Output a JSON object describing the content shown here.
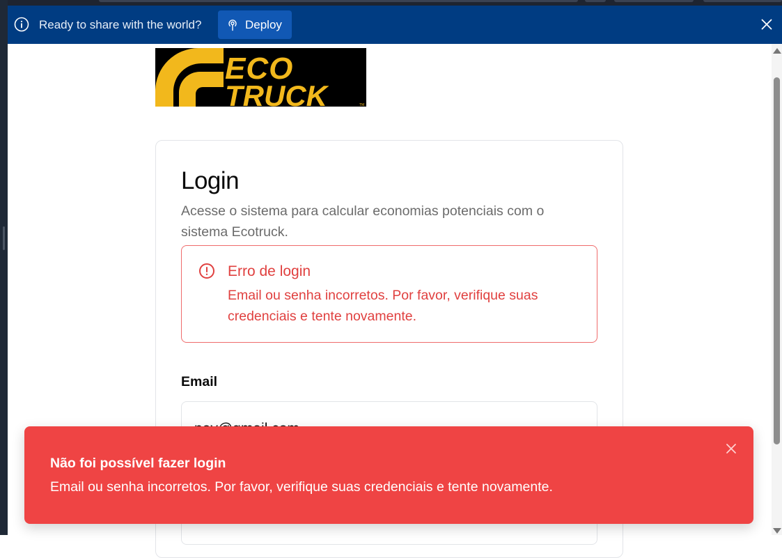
{
  "banner": {
    "message": "Ready to share with the world?",
    "deploy_label": "Deploy",
    "background": "#003c82"
  },
  "logo": {
    "line1": "ECO",
    "line2": "TRUCK",
    "tm": "TM",
    "brand_color": "#f2b81c"
  },
  "login": {
    "title": "Login",
    "description": "Acesse o sistema para calcular economias potenciais com o sistema Ecotruck.",
    "alert": {
      "title": "Erro de login",
      "text": "Email ou senha incorretos. Por favor, verifique suas credenciais e tente novamente.",
      "color": "#e0403f"
    },
    "email_label": "Email",
    "email_value": "ney@gmail.com"
  },
  "toast": {
    "title": "Não foi possível fazer login",
    "text": "Email ou senha incorretos. Por favor, verifique suas credenciais e tente novamente.",
    "color": "#ef4444"
  }
}
